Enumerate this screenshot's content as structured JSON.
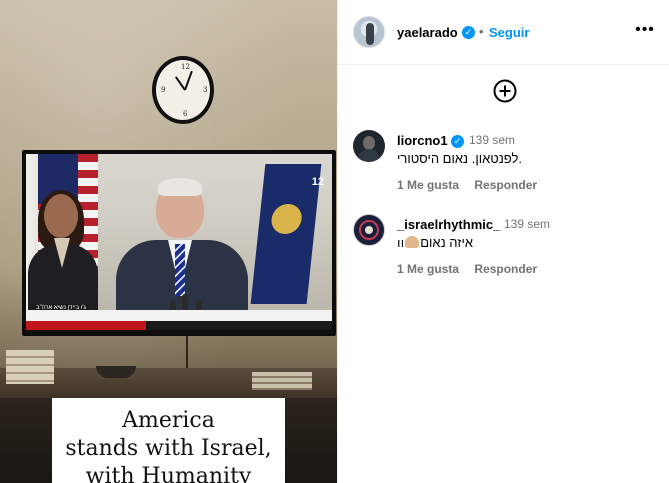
{
  "post": {
    "image_caption_lines": [
      "America",
      "stands with Israel,",
      "with Humanity"
    ],
    "tv_channel": "12",
    "tv_lower_name": "ג'ו ביידן נשיא ארה\"ב"
  },
  "header": {
    "username": "yaelarado",
    "separator": "•",
    "follow_label": "Seguir",
    "more_label": "•••"
  },
  "add_label": "+",
  "comments": [
    {
      "username": "liorcno1",
      "time": "139 sem",
      "text": "לפנטאון. נאום היסטורי.",
      "like_label": "1 Me gusta",
      "reply_label": "Responder"
    },
    {
      "username": "_israelrhythmic_",
      "time": "139 sem",
      "text_suffix": "איזה נאום",
      "text_prefix": "ıı",
      "like_label": "1 Me gusta",
      "reply_label": "Responder"
    }
  ],
  "colors": {
    "accent": "#0095f6",
    "muted": "#737373"
  },
  "icons": {
    "verified": "verified-badge-icon",
    "add": "plus-circle-icon",
    "more": "more-horizontal-icon",
    "emoji": "flexed-biceps-emoji"
  }
}
